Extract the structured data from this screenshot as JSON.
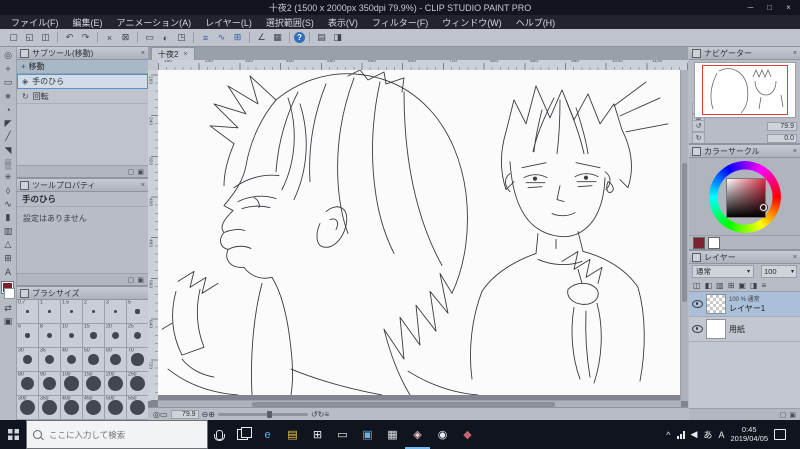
{
  "titlebar": {
    "title": "十夜2 (1500 x 2000px 350dpi 79.9%) - CLIP STUDIO PAINT PRO",
    "minimize": "─",
    "maximize": "□",
    "close": "×"
  },
  "menubar": {
    "items": [
      "ファイル(F)",
      "編集(E)",
      "アニメーション(A)",
      "レイヤー(L)",
      "選択範囲(S)",
      "表示(V)",
      "フィルター(F)",
      "ウィンドウ(W)",
      "ヘルプ(H)"
    ]
  },
  "toolbar": {
    "icons": [
      {
        "name": "new-file",
        "glyph": "▢"
      },
      {
        "name": "open-file",
        "glyph": "◱"
      },
      {
        "name": "save-file",
        "glyph": "◫"
      },
      {
        "sep": true
      },
      {
        "name": "undo",
        "glyph": "↶"
      },
      {
        "name": "redo",
        "glyph": "↷"
      },
      {
        "sep": true
      },
      {
        "name": "delete",
        "glyph": "×"
      },
      {
        "name": "delete-outside-selection",
        "glyph": "⊠"
      },
      {
        "sep": true
      },
      {
        "name": "deselect",
        "glyph": "▭"
      },
      {
        "name": "invert-selection",
        "glyph": "◐"
      },
      {
        "name": "select-border",
        "glyph": "◳"
      },
      {
        "sep": true
      },
      {
        "name": "snap-to-ruler",
        "glyph": "≡",
        "accent": true
      },
      {
        "name": "snap-to-special-ruler",
        "glyph": "∿",
        "accent": true
      },
      {
        "name": "snap-to-grid",
        "glyph": "⊞",
        "accent": true
      },
      {
        "sep": true
      },
      {
        "name": "angle-ruler",
        "glyph": "∠"
      },
      {
        "name": "grid",
        "glyph": "▦"
      },
      {
        "sep": true
      },
      {
        "name": "help",
        "glyph": "?",
        "round": true
      },
      {
        "sep": true
      },
      {
        "name": "material-palette",
        "glyph": "▤"
      },
      {
        "name": "workspace",
        "glyph": "◨"
      }
    ]
  },
  "toolstrip": {
    "tools": [
      {
        "name": "zoom-tool",
        "glyph": "◎"
      },
      {
        "name": "move-tool",
        "glyph": "+"
      },
      {
        "name": "selection-tool",
        "glyph": "▭"
      },
      {
        "name": "auto-select-tool",
        "glyph": "∗"
      },
      {
        "name": "eyedropper-tool",
        "glyph": "◔"
      },
      {
        "name": "pen-tool",
        "glyph": "◤"
      },
      {
        "name": "pencil-tool",
        "glyph": "╱"
      },
      {
        "name": "brush-tool",
        "glyph": "◥"
      },
      {
        "name": "airbrush-tool",
        "glyph": "▒"
      },
      {
        "name": "decoration-tool",
        "glyph": "✳"
      },
      {
        "name": "eraser-tool",
        "glyph": "◊"
      },
      {
        "name": "blend-tool",
        "glyph": "∿"
      },
      {
        "name": "fill-tool",
        "glyph": "▮"
      },
      {
        "name": "gradient-tool",
        "glyph": "▥"
      },
      {
        "name": "figure-tool",
        "glyph": "△"
      },
      {
        "name": "frame-border-tool",
        "glyph": "⊞"
      },
      {
        "name": "text-tool",
        "glyph": "A"
      }
    ],
    "tools2": [
      {
        "name": "swap-colors",
        "glyph": "⇄"
      },
      {
        "name": "screen-color",
        "glyph": "▣"
      }
    ]
  },
  "panels": {
    "subtool": {
      "title": "サブツール(移動)",
      "group": "移動",
      "group_icon": "+",
      "items": [
        {
          "label": "手のひら",
          "icon": "◈",
          "selected": true
        },
        {
          "label": "回転",
          "icon": "↻",
          "selected": false
        }
      ]
    },
    "toolprop": {
      "title": "ツールプロパティ",
      "tool": "手のひら",
      "empty": "設定はありません"
    },
    "brush": {
      "title": "ブラシサイズ",
      "sizes": [
        "0.7",
        "1",
        "1.5",
        "2",
        "3",
        "5",
        "6",
        "8",
        "10",
        "15",
        "20",
        "25",
        "30",
        "35",
        "40",
        "50",
        "60",
        "70",
        "80",
        "90",
        "100",
        "150",
        "200",
        "250",
        "300",
        "350",
        "400",
        "450",
        "500",
        "550"
      ]
    }
  },
  "document": {
    "tab": "十夜2",
    "tab_close": "×",
    "h_ruler": [
      "160",
      "240",
      "320",
      "400",
      "480",
      "560",
      "640",
      "720",
      "800",
      "880",
      "960",
      "1040",
      "1120"
    ],
    "v_ruler": [
      "160",
      "240",
      "320",
      "400",
      "480",
      "560",
      "640",
      "720"
    ],
    "status": {
      "icons_left": [
        "◎",
        "▭"
      ],
      "zoom": "79.9",
      "icons_mid": [
        "⊖",
        "⊕"
      ],
      "icons_right": [
        "↺",
        "↻",
        "≡"
      ]
    }
  },
  "navigator": {
    "title": "ナビゲーター",
    "zoom_icons": [
      "⊖",
      "⊕",
      "▭",
      "◫"
    ],
    "zoom": "79.9",
    "rotate_icons": [
      "↺",
      "↻",
      "⇄"
    ],
    "rotate": "0.0"
  },
  "color": {
    "title": "カラーサークル",
    "main": "#7c2230",
    "sub": "#ffffff"
  },
  "layers": {
    "title": "レイヤー",
    "blend": "通常",
    "opacity": "100",
    "toolbar": [
      "◫",
      "◧",
      "▥",
      "⊞",
      "▣",
      "◨",
      "≡"
    ],
    "items": [
      {
        "meta": "100 % 通常",
        "name": "レイヤー1",
        "selected": true,
        "thumb": "checker"
      },
      {
        "meta": "",
        "name": "用紙",
        "selected": false,
        "thumb": "paper"
      }
    ]
  },
  "taskbar": {
    "search_placeholder": "ここに入力して検索",
    "icons": [
      {
        "name": "edge-browser",
        "glyph": "e",
        "color": "#55b2f0"
      },
      {
        "name": "file-explorer",
        "glyph": "▤",
        "color": "#f3c84b"
      },
      {
        "name": "store",
        "glyph": "⊞",
        "color": "#e9edf2"
      },
      {
        "name": "mail",
        "glyph": "▭",
        "color": "#e9edf2"
      },
      {
        "name": "photos",
        "glyph": "▣",
        "color": "#67b0e8"
      },
      {
        "name": "calculator",
        "glyph": "▦",
        "color": "#dfe3ea"
      },
      {
        "name": "clip-studio-paint",
        "glyph": "◈",
        "color": "#f0c8d0",
        "running": true
      },
      {
        "name": "browser",
        "glyph": "◉",
        "color": "#e9edf2"
      },
      {
        "name": "paint-app",
        "glyph": "◆",
        "color": "#c56276"
      }
    ],
    "tray": {
      "caret": "^",
      "volume": "◀",
      "ime": "あ",
      "lang": "A",
      "time": "0:45",
      "date": "2019/04/05"
    }
  },
  "ui": {
    "panel_close": "×",
    "footer_icons": [
      "▢",
      "▣"
    ],
    "dropdown": "▾"
  }
}
